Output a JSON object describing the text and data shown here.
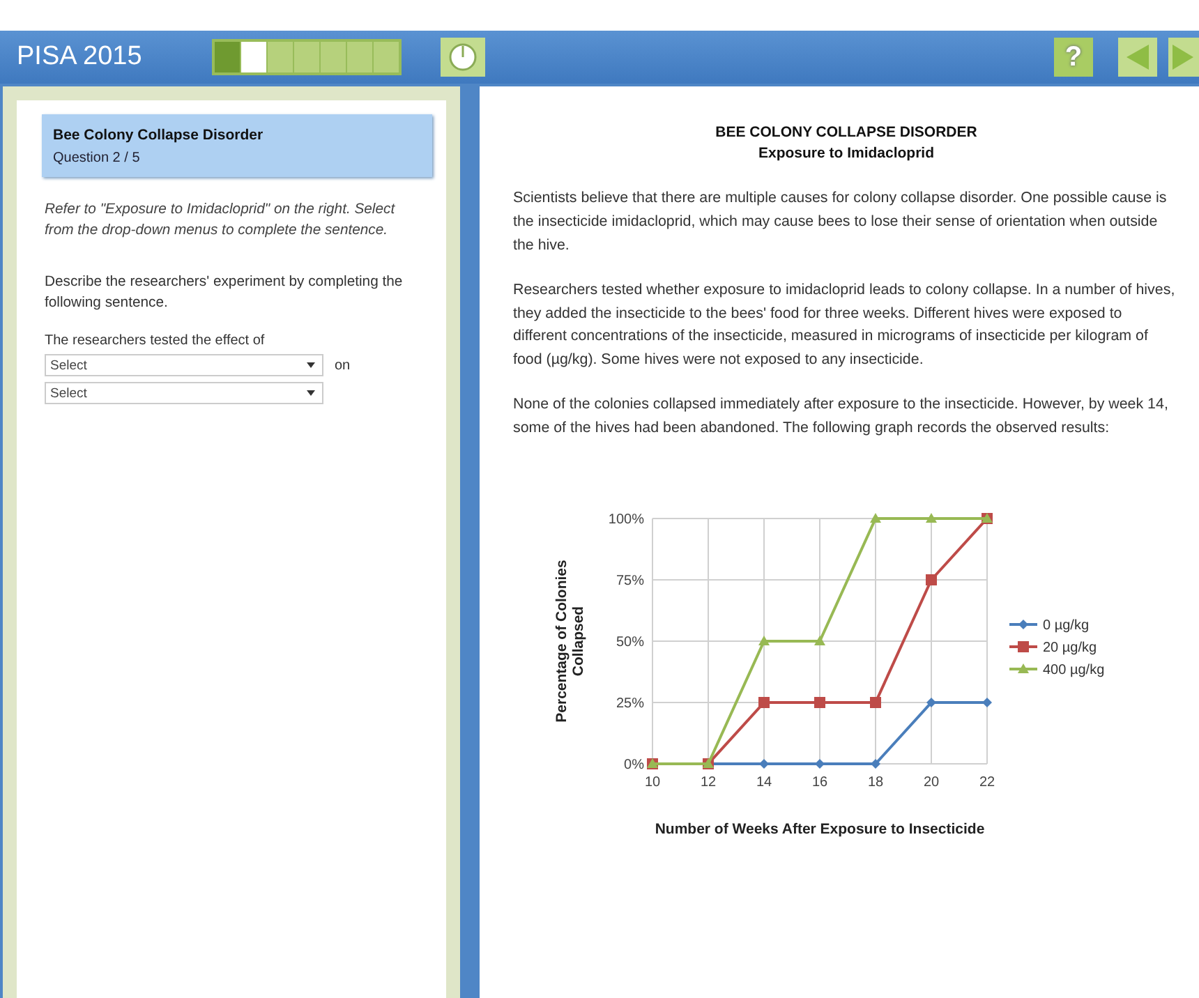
{
  "header": {
    "title": "PISA 2015",
    "progress": [
      {
        "completed": true,
        "selected": false
      },
      {
        "completed": false,
        "selected": true
      },
      {
        "completed": false,
        "selected": false
      },
      {
        "completed": false,
        "selected": false
      },
      {
        "completed": false,
        "selected": false
      },
      {
        "completed": false,
        "selected": false
      },
      {
        "completed": false,
        "selected": false
      }
    ],
    "help_button": "?"
  },
  "question_panel": {
    "unit_title": "Bee Colony Collapse Disorder",
    "question_number": "Question 2 / 5",
    "instruction": "Refer to \"Exposure to Imidacloprid\" on the right. Select from the drop-down menus to complete the sentence.",
    "prompt": "Describe the researchers' experiment by completing the following sentence.",
    "sentence_start": "The researchers tested the effect of",
    "dropdowns": [
      {
        "value": "Select",
        "after": "on"
      },
      {
        "value": "Select"
      }
    ]
  },
  "stimulus": {
    "title": "BEE COLONY COLLAPSE DISORDER",
    "subtitle": "Exposure to Imidacloprid",
    "paragraphs": [
      "Scientists believe that there are multiple causes for colony collapse disorder. One possible cause is the insecticide imidacloprid, which may cause bees to lose their sense of orientation when outside the hive.",
      "Researchers tested whether exposure to imidacloprid leads to colony collapse. In a number of hives, they added the insecticide to the bees' food for three weeks. Different hives were exposed to different concentrations of the insecticide, measured in micrograms of insecticide per kilogram of food (µg/kg). Some hives were not exposed to any insecticide.",
      "None of the colonies collapsed immediately after exposure to the insecticide. However, by week 14, some of the hives had been abandoned. The following graph records the observed results:"
    ],
    "chart_data": {
      "type": "line",
      "xlabel": "Number of Weeks After Exposure to Insecticide",
      "ylabel": "Percentage of Colonies Collapsed",
      "categories": [
        "10",
        "12",
        "14",
        "16",
        "18",
        "20",
        "22"
      ],
      "ylim": [
        0,
        1
      ],
      "grid": true,
      "legend": true,
      "yticks": [
        {
          "value": 0,
          "label": "0%"
        },
        {
          "value": 0.25,
          "label": "25%"
        },
        {
          "value": 0.5,
          "label": "50%"
        },
        {
          "value": 0.75,
          "label": "75%"
        },
        {
          "value": 1,
          "label": "100%"
        }
      ],
      "series": [
        {
          "name": "0 µg/kg",
          "color": "#4a7ebb",
          "marker": "diamond",
          "values": [
            0,
            0,
            0,
            0,
            0,
            0.25,
            0.25
          ]
        },
        {
          "name": "20 µg/kg",
          "color": "#be4b48",
          "marker": "square",
          "values": [
            0,
            0,
            0.25,
            0.25,
            0.25,
            0.75,
            1
          ]
        },
        {
          "name": "400 µg/kg",
          "color": "#98b954",
          "marker": "triangle",
          "values": [
            0,
            0,
            0.5,
            0.5,
            1,
            1,
            1
          ]
        }
      ]
    }
  }
}
